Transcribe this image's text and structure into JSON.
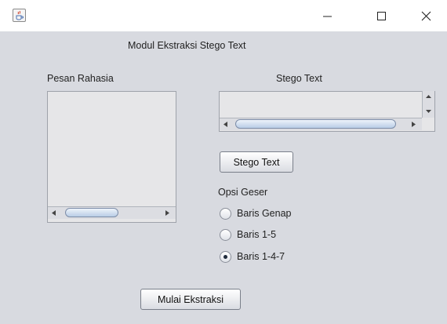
{
  "window": {
    "title": "",
    "controls": {
      "minimize": "—",
      "maximize": "☐",
      "close": "✕"
    }
  },
  "header": {
    "title": "Modul Ekstraksi Stego Text"
  },
  "secret": {
    "label": "Pesan Rahasia",
    "value": ""
  },
  "stego": {
    "label": "Stego Text",
    "value": "",
    "button_label": "Stego Text"
  },
  "options": {
    "label": "Opsi Geser",
    "items": [
      {
        "label": "Baris Genap",
        "selected": false
      },
      {
        "label": "Baris 1-5",
        "selected": false
      },
      {
        "label": "Baris 1-4-7",
        "selected": true
      }
    ]
  },
  "footer": {
    "button_label": "Mulai Ekstraksi"
  }
}
